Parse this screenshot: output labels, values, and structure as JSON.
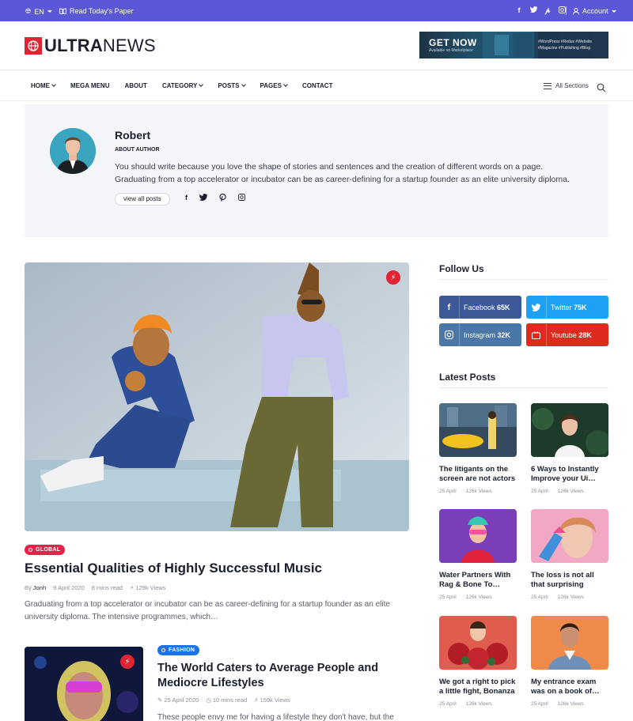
{
  "topbar": {
    "language": "EN",
    "paper_link": "Read Today's Paper",
    "social_icons": [
      "facebook-icon",
      "twitter-icon",
      "pinterest-icon",
      "instagram-icon"
    ],
    "account": "Account"
  },
  "header": {
    "logo_bold": "ULTRA",
    "logo_light": "NEWS",
    "ad": {
      "title": "GET NOW",
      "subtitle": "Available on Marketplace",
      "tags": "#WordPress #Redux #Website #Magazine #Publishing #Blog"
    }
  },
  "nav": {
    "items": [
      {
        "label": "HOME",
        "has_dropdown": true
      },
      {
        "label": "MEGA MENU",
        "has_dropdown": false
      },
      {
        "label": "ABOUT",
        "has_dropdown": false
      },
      {
        "label": "CATEGORY",
        "has_dropdown": true
      },
      {
        "label": "POSTS",
        "has_dropdown": true
      },
      {
        "label": "PAGES",
        "has_dropdown": true
      },
      {
        "label": "CONTACT",
        "has_dropdown": false
      }
    ],
    "all_sections": "All Sections"
  },
  "author": {
    "name": "Robert",
    "role": "ABOUT AUTHOR",
    "bio": "You should write because you love the shape of stories and sentences and the creation of different words on a page. Graduating from a top accelerator or incubator can be as career-defining for a startup founder as an elite university diploma.",
    "view_posts": "view all posts"
  },
  "featured_post": {
    "category": "GLOBAL",
    "category_color": "#e8204a",
    "title": "Essential Qualities of Highly Successful Music",
    "author_prefix": "By",
    "author": "Jonh",
    "date": "9 April 2020",
    "read_time": "8 mins read",
    "views": "129k Views",
    "excerpt": "Graduating from a top accelerator or incubator can be as career-defining for a startup founder as an elite university diploma. The intensive programmes, which…"
  },
  "second_post": {
    "category": "FASHION",
    "category_color": "#1a73e8",
    "title": "The World Caters to Average People and Mediocre Lifestyles",
    "date": "25 April 2020",
    "read_time": "10 mins read",
    "views": "159k Views",
    "excerpt": "These people envy me for having a lifestyle they don't have, but the truth is,"
  },
  "sidebar": {
    "follow_heading": "Follow Us",
    "follow": [
      {
        "network": "Facebook",
        "count": "65K",
        "color": "#3b5998",
        "icon": "facebook-icon"
      },
      {
        "network": "Twitter",
        "count": "75K",
        "color": "#1da1f2",
        "icon": "twitter-icon"
      },
      {
        "network": "Instagram",
        "count": "32K",
        "color": "#4a76a8",
        "icon": "instagram-icon"
      },
      {
        "network": "Youtube",
        "count": "28K",
        "color": "#e02a20",
        "icon": "youtube-icon"
      }
    ],
    "latest_heading": "Latest Posts",
    "latest": [
      {
        "title": "The litigants on the screen are not actors",
        "date": "25 April",
        "views": "126k Views"
      },
      {
        "title": "6 Ways to Instantly Improve your Ui…",
        "date": "25 April",
        "views": "126k Views"
      },
      {
        "title": "Water Partners With Rag & Bone To…",
        "date": "25 April",
        "views": "126k Views"
      },
      {
        "title": "The loss is not all that surprising",
        "date": "25 April",
        "views": "126k Views"
      },
      {
        "title": "We got a right to pick a little fight, Bonanza",
        "date": "25 April",
        "views": "126k Views"
      },
      {
        "title": "My entrance exam was on a book of…",
        "date": "25 April",
        "views": "126k Views"
      }
    ]
  },
  "colors": {
    "topbar": "#5b57d6",
    "brand_red": "#e02434",
    "author_bg": "#f4f5f9"
  }
}
